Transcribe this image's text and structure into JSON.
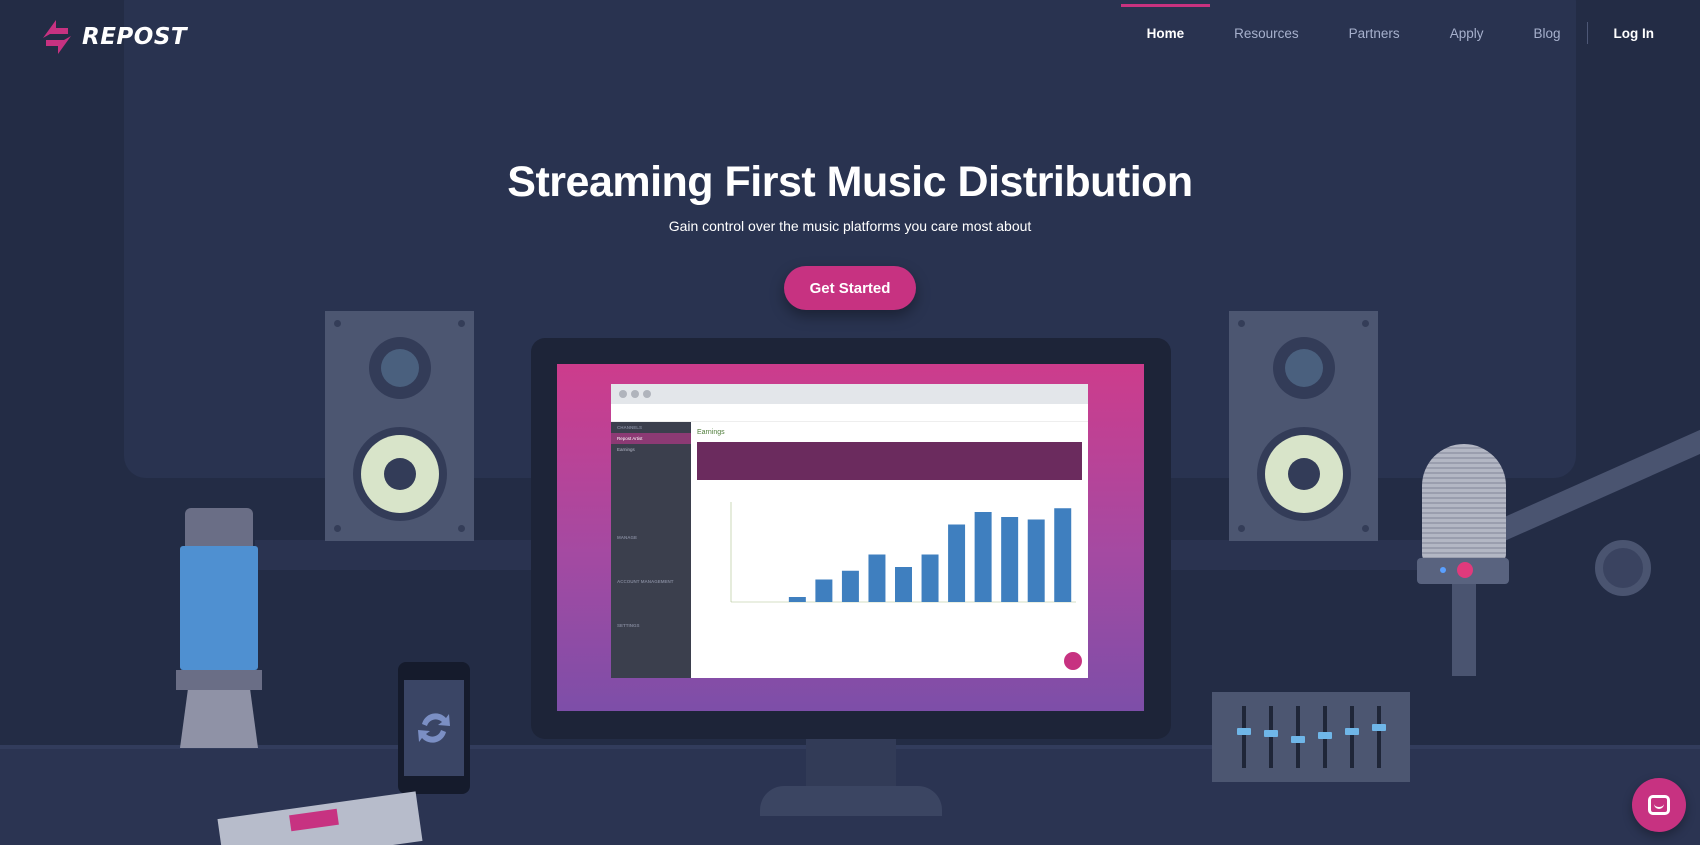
{
  "brand": {
    "name": "REPOST"
  },
  "nav": {
    "items": [
      {
        "label": "Home",
        "active": true
      },
      {
        "label": "Resources",
        "active": false
      },
      {
        "label": "Partners",
        "active": false
      },
      {
        "label": "Apply",
        "active": false
      },
      {
        "label": "Blog",
        "active": false
      }
    ],
    "login": "Log In"
  },
  "hero": {
    "title": "Streaming First Music Distribution",
    "subtitle": "Gain control over the music platforms you care most about",
    "cta": "Get Started"
  },
  "colors": {
    "accent": "#c73281",
    "background": "#232c45",
    "panel": "#293350"
  },
  "icons": [
    "repost-logo-icon",
    "chat-icon",
    "repost-refresh-icon"
  ],
  "app_preview": {
    "page_title": "Earnings",
    "sidebar": [
      "CHANNELS",
      "Repost Artist",
      "Earnings",
      "MANAGE",
      "ACCOUNT MANAGEMENT",
      "SETTINGS"
    ],
    "chart_data": {
      "type": "bar",
      "values": [
        0,
        0,
        4,
        18,
        25,
        38,
        28,
        38,
        62,
        72,
        68,
        66,
        75
      ]
    }
  }
}
